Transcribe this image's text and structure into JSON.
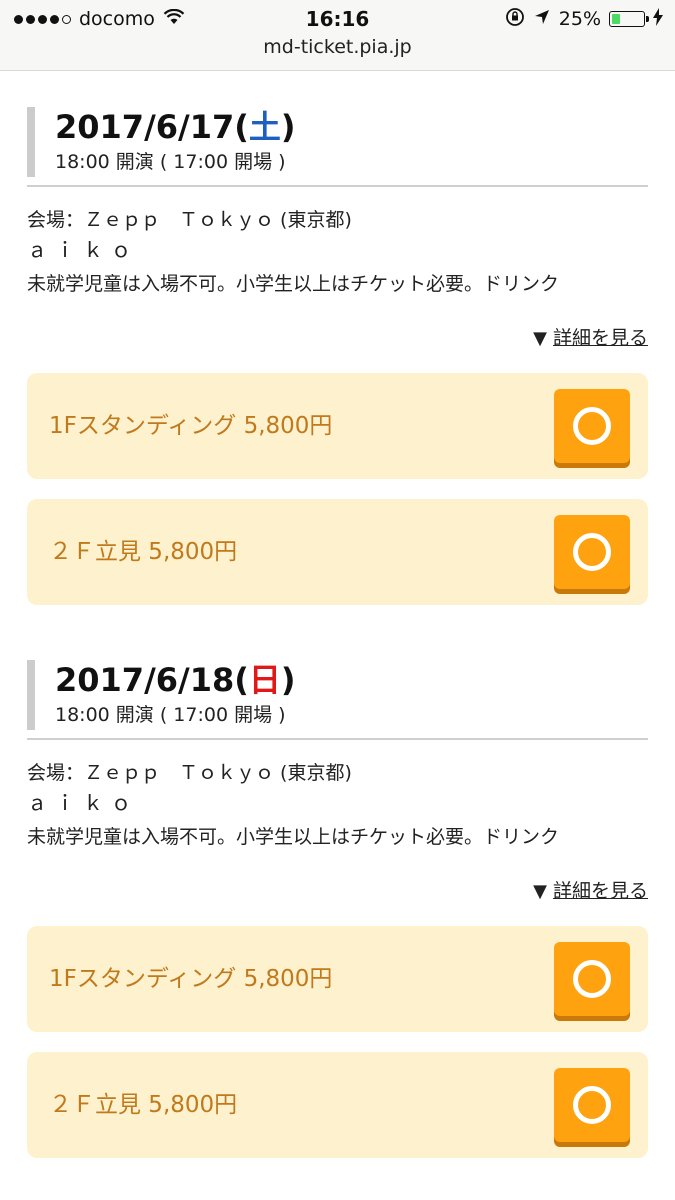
{
  "status_bar": {
    "carrier": "docomo",
    "time": "16:16",
    "battery_percent": "25%",
    "battery_level": 0.25,
    "url": "md-ticket.pia.jp"
  },
  "events": [
    {
      "date": "2017/6/17(",
      "day": "土",
      "date_close": ")",
      "time": "18:00 開演 ( 17:00 開場 )",
      "venue": "会場：Ｚｅｐｐ　Ｔｏｋｙｏ (東京都)",
      "artist": "ａｉｋｏ",
      "notice": "未就学児童は入場不可。小学生以上はチケット必要。ドリンク",
      "details_label": "詳細を見る",
      "tickets": [
        {
          "label": "1Fスタンディング 5,800円",
          "status": "available"
        },
        {
          "label": "２Ｆ立見 5,800円",
          "status": "available"
        }
      ]
    },
    {
      "date": "2017/6/18(",
      "day": "日",
      "date_close": ")",
      "time": "18:00 開演 ( 17:00 開場 )",
      "venue": "会場：Ｚｅｐｐ　Ｔｏｋｙｏ (東京都)",
      "artist": "ａｉｋｏ",
      "notice": "未就学児童は入場不可。小学生以上はチケット必要。ドリンク",
      "details_label": "詳細を見る",
      "tickets": [
        {
          "label": "1Fスタンディング 5,800円",
          "status": "available"
        },
        {
          "label": "２Ｆ立見 5,800円",
          "status": "available"
        }
      ]
    }
  ],
  "colors": {
    "saturday": "#1f5fbf",
    "sunday": "#e01818",
    "ticket_bg": "#fdf1ce",
    "ticket_text": "#c07a1c",
    "button": "#ffa20f"
  },
  "icons": [
    "signal-dots-icon",
    "wifi-icon",
    "orientation-lock-icon",
    "location-arrow-icon",
    "battery-icon",
    "charging-bolt-icon",
    "triangle-down-icon",
    "circle-available-icon"
  ]
}
